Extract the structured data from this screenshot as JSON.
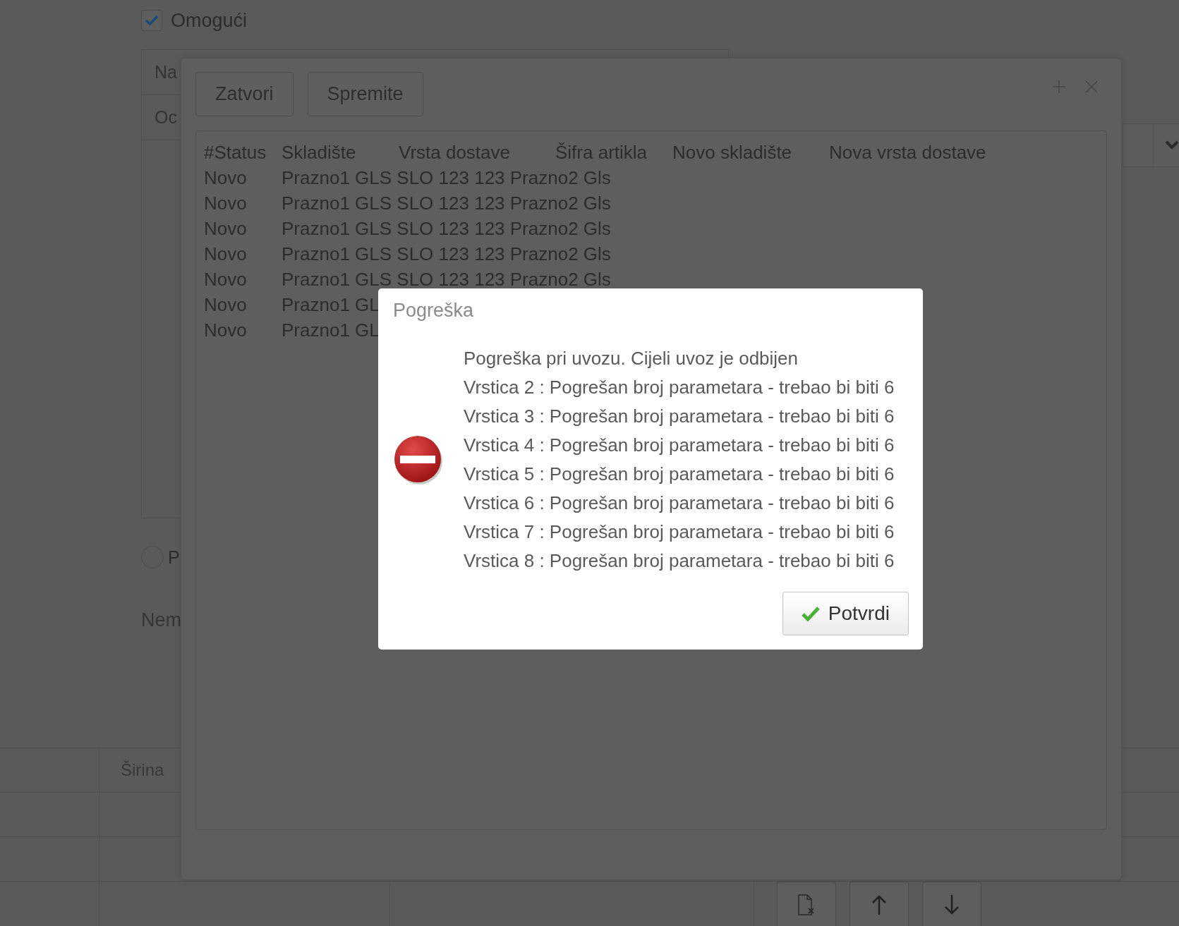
{
  "background": {
    "enable_checkbox": {
      "label": "Omogući",
      "checked": true
    },
    "table": {
      "header": "Na",
      "rows": [
        "Oc"
      ]
    },
    "radio": {
      "label": "P",
      "selected": false
    },
    "note": "Nem",
    "bottom_table": {
      "columns": [
        "Širina"
      ]
    }
  },
  "import_window": {
    "buttons": [
      "Zatvori",
      "Spremite"
    ],
    "header": [
      "#Status",
      "Skladište",
      "Vrsta dostave",
      "Šifra artikla",
      "Novo skladište",
      "Nova vrsta dostave"
    ],
    "rows": [
      [
        "Novo",
        "Prazno1 GLS SLO 123 123 Prazno2 Gls"
      ],
      [
        "Novo",
        "Prazno1 GLS SLO 123 123 Prazno2 Gls"
      ],
      [
        "Novo",
        "Prazno1 GLS SLO 123 123 Prazno2 Gls"
      ],
      [
        "Novo",
        "Prazno1 GLS SLO 123 123 Prazno2 Gls"
      ],
      [
        "Novo",
        "Prazno1 GLS SLO 123 123 Prazno2 Gls"
      ],
      [
        "Novo",
        "Prazno1 GL"
      ],
      [
        "Novo",
        "Prazno1 GL"
      ]
    ]
  },
  "error_dialog": {
    "title": "Pogreška",
    "message": "Pogreška pri uvozu. Cijeli uvoz je odbijen",
    "details": [
      "Vrstica 2 : Pogrešan broj parametara - trebao bi biti 6",
      "Vrstica 3 : Pogrešan broj parametara - trebao bi biti 6",
      "Vrstica 4 : Pogrešan broj parametara - trebao bi biti 6",
      "Vrstica 5 : Pogrešan broj parametara - trebao bi biti 6",
      "Vrstica 6 : Pogrešan broj parametara - trebao bi biti 6",
      "Vrstica 7 : Pogrešan broj parametara - trebao bi biti 6",
      "Vrstica 8 : Pogrešan broj parametara - trebao bi biti 6"
    ],
    "button": "Potvrdi"
  }
}
